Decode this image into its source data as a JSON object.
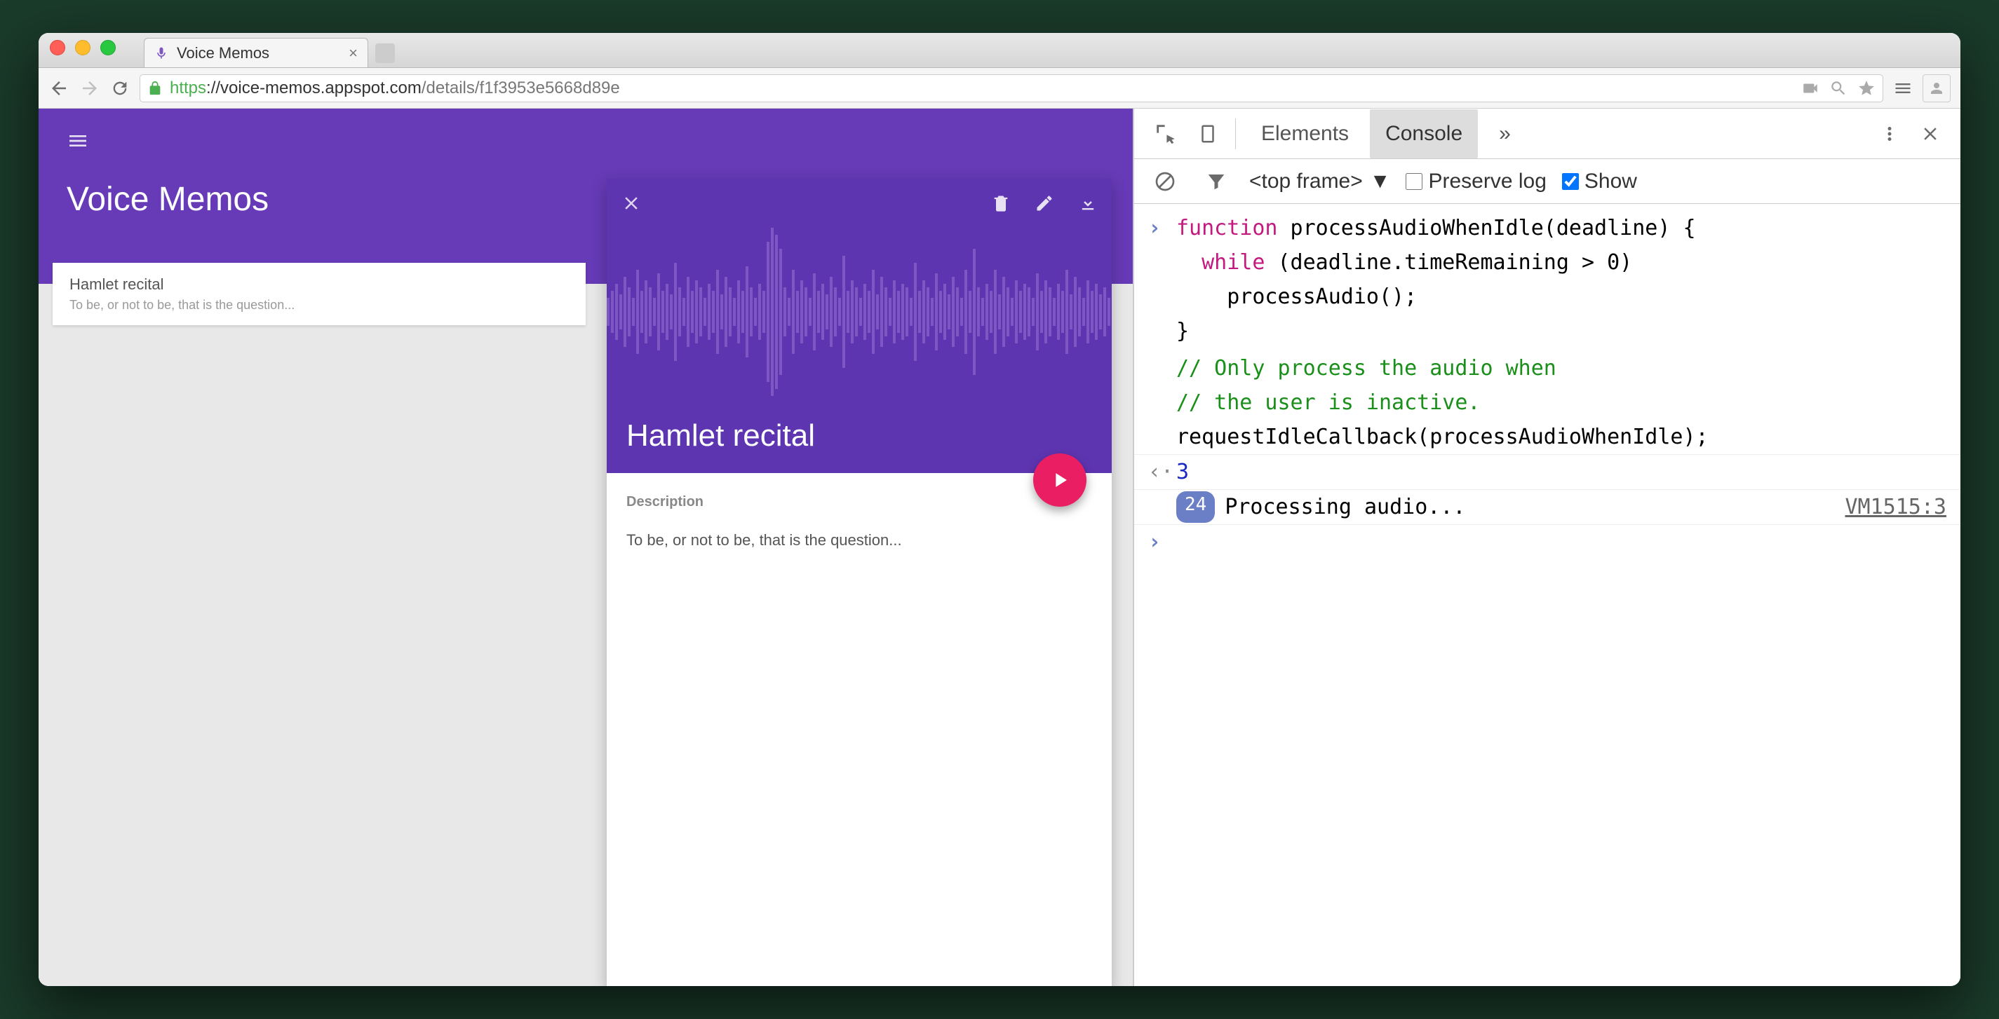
{
  "browser": {
    "tab_title": "Voice Memos",
    "url_scheme": "https",
    "url_host": "://voice-memos.appspot.com",
    "url_path": "/details/f1f3953e5668d89e"
  },
  "app": {
    "title": "Voice Memos",
    "list": {
      "item_title": "Hamlet recital",
      "item_desc": "To be, or not to be, that is the question..."
    },
    "detail": {
      "title": "Hamlet recital",
      "desc_label": "Description",
      "desc_text": "To be, or not to be, that is the question..."
    }
  },
  "devtools": {
    "tabs": {
      "elements": "Elements",
      "console": "Console",
      "more": "»"
    },
    "toolbar": {
      "frame": "<top frame>",
      "preserve": "Preserve log",
      "show": "Show"
    },
    "console": {
      "code_l1": "function processAudioWhenIdle(deadline) {",
      "code_l1_kw": "function",
      "code_l1_rest": " processAudioWhenIdle(deadline) {",
      "code_l2_kw": "while",
      "code_l2_rest": " (deadline.timeRemaining > 0)",
      "code_l3": "    processAudio();",
      "code_l4": "}",
      "code_l5": "",
      "code_c1": "// Only process the audio when",
      "code_c2": "// the user is inactive.",
      "code_l6": "requestIdleCallback(processAudioWhenIdle);",
      "result": "3",
      "log_count": "24",
      "log_msg": "Processing audio...",
      "log_src": "VM1515:3"
    }
  }
}
